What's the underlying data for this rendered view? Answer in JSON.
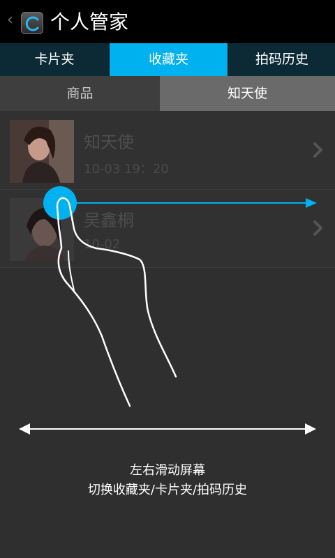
{
  "header": {
    "title": "个人管家",
    "back_icon": "chevron-left-icon",
    "app_icon": "app-logo-icon"
  },
  "tabs": [
    {
      "label": "卡片夹",
      "active": false
    },
    {
      "label": "收藏夹",
      "active": true
    },
    {
      "label": "拍码历史",
      "active": false
    }
  ],
  "subtabs": [
    {
      "label": "商品",
      "active": false
    },
    {
      "label": "知天使",
      "active": true
    }
  ],
  "items": [
    {
      "title": "知天使",
      "time": "10-03 19：20"
    },
    {
      "title": "吴鑫桐",
      "time": "10-02"
    }
  ],
  "overlay": {
    "hint_line1": "左右滑动屏幕",
    "hint_line2": "切换收藏夹/卡片夹/拍码历史",
    "gesture_icon": "swipe-hand-icon"
  },
  "colors": {
    "accent": "#00b1f0",
    "title_bar": "#000000",
    "tab_bar": "#0b2a36",
    "background": "#2f2f2f"
  }
}
